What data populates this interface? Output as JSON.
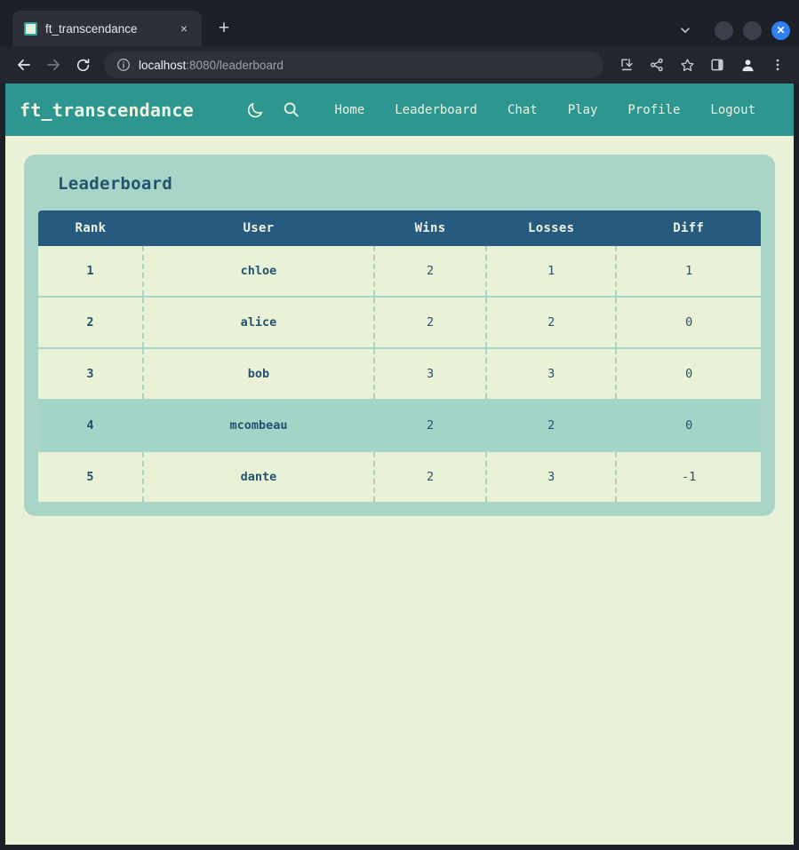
{
  "browser": {
    "tab": {
      "title": "ft_transcendance",
      "favicon": "app-square-icon",
      "close_label": "×"
    },
    "new_tab_label": "+",
    "tab_search_label": "⌄",
    "window_controls": {
      "minimize_label": "",
      "maximize_label": "",
      "close_label": "✕"
    },
    "toolbar": {
      "back_label": "←",
      "forward_label": "→",
      "reload_label": "⟳",
      "site_info_icon": "info-circle-icon",
      "url_host": "localhost",
      "url_rest": ":8080/leaderboard",
      "icons": [
        {
          "name": "download-icon"
        },
        {
          "name": "share-icon"
        },
        {
          "name": "bookmark-star-icon"
        },
        {
          "name": "side-panel-icon"
        },
        {
          "name": "profile-avatar-icon"
        },
        {
          "name": "more-menu-icon"
        }
      ]
    }
  },
  "app": {
    "brand": "ft_transcendance",
    "theme_toggle_icon": "moon-icon",
    "search_icon": "search-icon",
    "nav_links": [
      {
        "label": "Home",
        "name": "nav-link-home"
      },
      {
        "label": "Leaderboard",
        "name": "nav-link-leaderboard"
      },
      {
        "label": "Chat",
        "name": "nav-link-chat"
      },
      {
        "label": "Play",
        "name": "nav-link-play"
      },
      {
        "label": "Profile",
        "name": "nav-link-profile"
      },
      {
        "label": "Logout",
        "name": "nav-link-logout"
      }
    ],
    "colors": {
      "navbar_bg": "#2d9690",
      "page_bg": "#e9f2d7",
      "card_bg": "#a8d5c7",
      "table_header_bg": "#265a7e",
      "text_dark": "#23536f",
      "highlight_row_bg": "#a3d4c8"
    }
  },
  "leaderboard": {
    "title": "Leaderboard",
    "columns": [
      "Rank",
      "User",
      "Wins",
      "Losses",
      "Diff"
    ],
    "rows": [
      {
        "rank": "1",
        "user": "chloe",
        "wins": "2",
        "losses": "1",
        "diff": "1",
        "highlight": false
      },
      {
        "rank": "2",
        "user": "alice",
        "wins": "2",
        "losses": "2",
        "diff": "0",
        "highlight": false
      },
      {
        "rank": "3",
        "user": "bob",
        "wins": "3",
        "losses": "3",
        "diff": "0",
        "highlight": false
      },
      {
        "rank": "4",
        "user": "mcombeau",
        "wins": "2",
        "losses": "2",
        "diff": "0",
        "highlight": true
      },
      {
        "rank": "5",
        "user": "dante",
        "wins": "2",
        "losses": "3",
        "diff": "-1",
        "highlight": false
      }
    ]
  }
}
